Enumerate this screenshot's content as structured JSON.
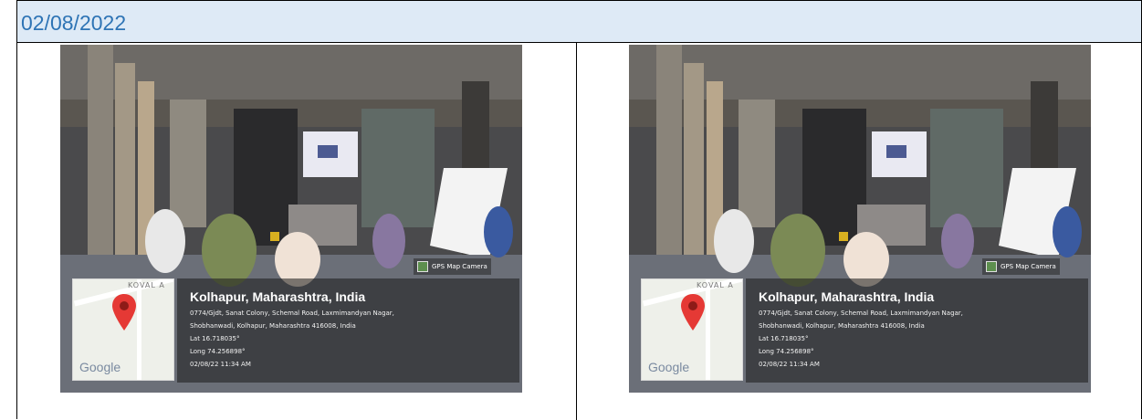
{
  "header": {
    "date": "02/08/2022"
  },
  "photos": [
    {
      "watermark": "GPS Map Camera",
      "map": {
        "road_label": "KOVAL A",
        "provider": "Google"
      },
      "geo": {
        "city": "Kolhapur, Maharashtra, India",
        "address_line1": "0774/Gjdt, Sanat Colony, Schemal Road, Laxmimandyan Nagar,",
        "address_line2": "Shobhanwadi, Kolhapur, Maharashtra 416008, India",
        "lat": "Lat 16.718035°",
        "long": "Long 74.256898°",
        "timestamp": "02/08/22 11:34 AM"
      }
    },
    {
      "watermark": "GPS Map Camera",
      "map": {
        "road_label": "KOVAL A",
        "provider": "Google"
      },
      "geo": {
        "city": "Kolhapur, Maharashtra, India",
        "address_line1": "0774/Gjdt, Sanat Colony, Schemal Road, Laxmimandyan Nagar,",
        "address_line2": "Shobhanwadi, Kolhapur, Maharashtra 416008, India",
        "lat": "Lat 16.718035°",
        "long": "Long 74.256898°",
        "timestamp": "02/08/22 11:34 AM"
      }
    }
  ]
}
